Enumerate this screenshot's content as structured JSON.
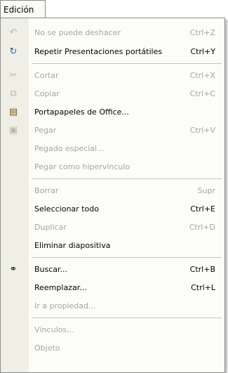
{
  "menubar": {
    "title": "Edición"
  },
  "menu": {
    "items": [
      {
        "label": "No se puede deshacer",
        "shortcut": "Ctrl+Z",
        "enabled": false,
        "icon": "undo-icon"
      },
      {
        "label": "Repetir Presentaciones portátiles",
        "shortcut": "Ctrl+Y",
        "enabled": true,
        "icon": "redo-icon"
      },
      {
        "label": "Cortar",
        "shortcut": "Ctrl+X",
        "enabled": false,
        "icon": "cut-icon"
      },
      {
        "label": "Copiar",
        "shortcut": "Ctrl+C",
        "enabled": false,
        "icon": "copy-icon"
      },
      {
        "label": "Portapapeles de Office...",
        "shortcut": "",
        "enabled": true,
        "icon": "office-clipboard-icon"
      },
      {
        "label": "Pegar",
        "shortcut": "Ctrl+V",
        "enabled": false,
        "icon": "paste-icon"
      },
      {
        "label": "Pegado especial...",
        "shortcut": "",
        "enabled": false,
        "icon": ""
      },
      {
        "label": "Pegar como hipervínculo",
        "shortcut": "",
        "enabled": false,
        "icon": ""
      },
      {
        "label": "Borrar",
        "shortcut": "Supr",
        "enabled": false,
        "icon": ""
      },
      {
        "label": "Seleccionar todo",
        "shortcut": "Ctrl+E",
        "enabled": true,
        "icon": ""
      },
      {
        "label": "Duplicar",
        "shortcut": "Ctrl+D",
        "enabled": false,
        "icon": ""
      },
      {
        "label": "Eliminar diapositiva",
        "shortcut": "",
        "enabled": true,
        "icon": ""
      },
      {
        "label": "Buscar...",
        "shortcut": "Ctrl+B",
        "enabled": true,
        "icon": "binoculars-icon"
      },
      {
        "label": "Reemplazar...",
        "shortcut": "Ctrl+L",
        "enabled": true,
        "icon": ""
      },
      {
        "label": "Ir a propiedad...",
        "shortcut": "",
        "enabled": false,
        "icon": ""
      },
      {
        "label": "Vínculos...",
        "shortcut": "",
        "enabled": false,
        "icon": ""
      },
      {
        "label": "Objeto",
        "shortcut": "",
        "enabled": false,
        "icon": ""
      }
    ]
  }
}
